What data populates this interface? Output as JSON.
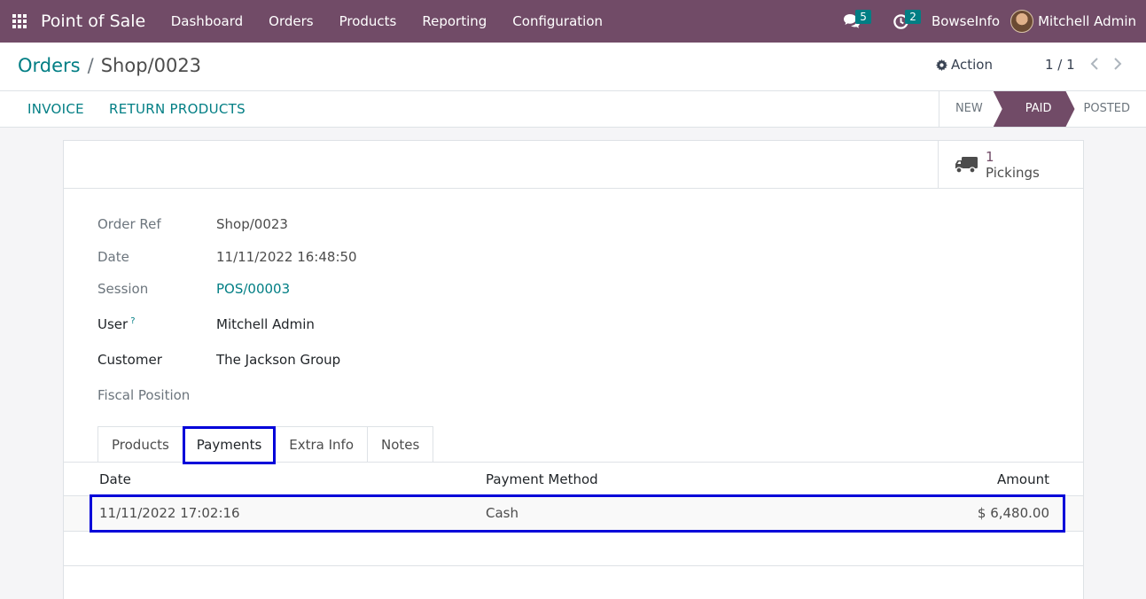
{
  "navbar": {
    "app_name": "Point of Sale",
    "menu": [
      "Dashboard",
      "Orders",
      "Products",
      "Reporting",
      "Configuration"
    ],
    "messages_count": "5",
    "activities_count": "2",
    "company": "BowseInfo",
    "user_name": "Mitchell Admin",
    "bg_color": "#714b67"
  },
  "control_panel": {
    "breadcrumb_parent": "Orders",
    "breadcrumb_separator": "/",
    "breadcrumb_current": "Shop/0023",
    "action_label": "Action",
    "pager": "1 / 1"
  },
  "statusbar": {
    "invoice_label": "INVOICE",
    "return_label": "RETURN PRODUCTS",
    "stages": [
      "NEW",
      "PAID",
      "POSTED"
    ],
    "active_stage": "PAID"
  },
  "smart_button": {
    "count": "1",
    "label": "Pickings",
    "icon": "truck-icon"
  },
  "fields": {
    "order_ref": {
      "label": "Order Ref",
      "value": "Shop/0023"
    },
    "date": {
      "label": "Date",
      "value": "11/11/2022 16:48:50"
    },
    "session": {
      "label": "Session",
      "value": "POS/00003"
    },
    "user": {
      "label": "User",
      "help": "?",
      "value": "Mitchell Admin"
    },
    "customer": {
      "label": "Customer",
      "value": "The Jackson Group"
    },
    "fiscal_position": {
      "label": "Fiscal Position",
      "value": ""
    }
  },
  "tabs": [
    "Products",
    "Payments",
    "Extra Info",
    "Notes"
  ],
  "active_tab": "Payments",
  "payments": {
    "columns": [
      "Date",
      "Payment Method",
      "Amount"
    ],
    "rows": [
      {
        "date": "11/11/2022 17:02:16",
        "method": "Cash",
        "amount": "$ 6,480.00"
      }
    ]
  },
  "colors": {
    "accent": "#017e84",
    "brand": "#714b67",
    "highlight": "#0000d9"
  }
}
